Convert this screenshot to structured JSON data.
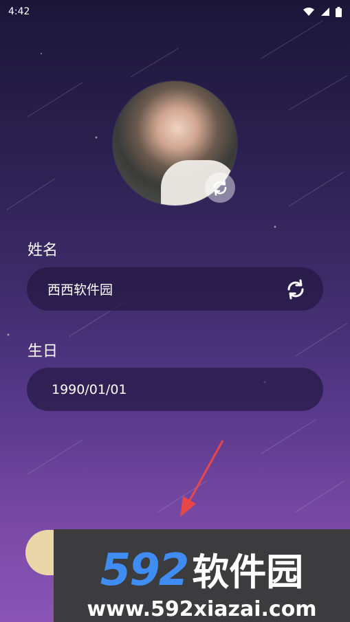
{
  "status_bar": {
    "time": "4:42",
    "icons": [
      "wifi-icon",
      "signal-icon",
      "battery-icon"
    ]
  },
  "profile": {
    "avatar_icon": "avatar",
    "avatar_refresh_icon": "refresh-icon",
    "name_label": "姓名",
    "name_value": "西西软件园",
    "name_refresh_icon": "refresh-icon",
    "birthday_label": "生日",
    "birthday_value": "1990/01/01"
  },
  "watermark": {
    "number": "592",
    "brand": "软件园",
    "url": "www.592xiazai.com"
  },
  "colors": {
    "bg_top": "#1b1638",
    "bg_bottom": "#8a55b6",
    "field_bg": "#2a1c48",
    "button_bg": "#ead6a9",
    "arrow": "#e8474a",
    "watermark_bg": "#3c3c3e",
    "watermark_blue": "#3f8cf2"
  }
}
